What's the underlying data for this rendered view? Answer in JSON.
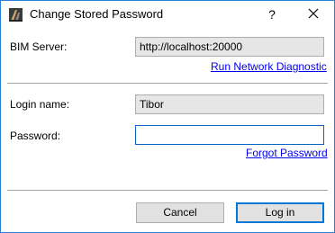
{
  "window": {
    "title": "Change Stored Password",
    "accent_color": "#2b7fd6",
    "help_glyph": "?",
    "icons": [
      "app-icon",
      "help-icon",
      "close-icon"
    ]
  },
  "server": {
    "label": "BIM Server:",
    "value": "http://localhost:20000",
    "diagnostic_link": "Run Network Diagnostic"
  },
  "login": {
    "name_label": "Login name:",
    "name_value": "Tibor",
    "password_label": "Password:",
    "password_value": "",
    "forgot_link": "Forgot Password"
  },
  "buttons": {
    "cancel": "Cancel",
    "login": "Log in"
  }
}
